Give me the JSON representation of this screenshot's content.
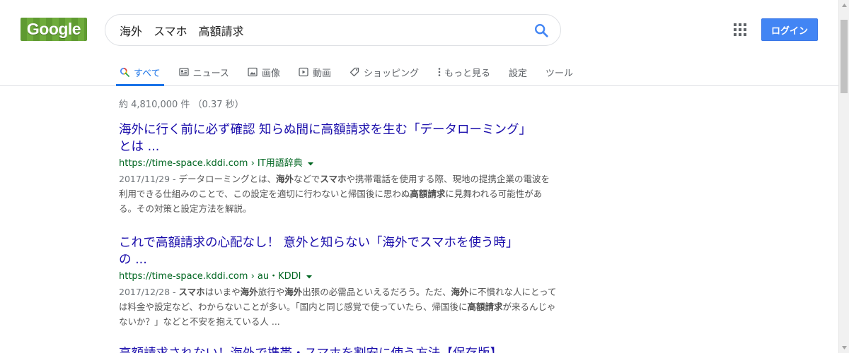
{
  "logo": {
    "text": "Google"
  },
  "search": {
    "query": "海外　スマホ　高額請求"
  },
  "header": {
    "login_label": "ログイン"
  },
  "tabs": [
    {
      "label": "すべて",
      "icon": "search-icon",
      "active": true
    },
    {
      "label": "ニュース",
      "icon": "news-icon"
    },
    {
      "label": "画像",
      "icon": "image-icon"
    },
    {
      "label": "動画",
      "icon": "video-icon"
    },
    {
      "label": "ショッピング",
      "icon": "tag-icon"
    },
    {
      "label": "もっと見る",
      "icon": "more-dots-icon"
    },
    {
      "label": "設定"
    },
    {
      "label": "ツール"
    }
  ],
  "stats": "約 4,810,000 件 （0.37 秒）",
  "results": [
    {
      "title_line1": "海外に行く前に必ず確認 知らぬ間に高額請求を生む「データローミング」",
      "title_line2": "とは ...",
      "url": "https://time-space.kddi.com › IT用語辞典",
      "date": "2017/11/29 - ",
      "snippet": [
        "データローミングとは、",
        {
          "b": "海外"
        },
        "などで",
        {
          "b": "スマホ"
        },
        "や携帯電話を使用する際、現地の提携企業の電波を利用できる仕組みのことで、この設定を適切に行わないと帰国後に思わぬ",
        {
          "b": "高額請求"
        },
        "に見舞われる可能性がある。その対策と設定方法を解説。"
      ]
    },
    {
      "title_line1": "これで高額請求の心配なし！ 意外と知らない「海外でスマホを使う時」",
      "title_line2": "の ...",
      "url": "https://time-space.kddi.com › au・KDDI",
      "date": "2017/12/28 - ",
      "snippet": [
        {
          "b": "スマホ"
        },
        "はいまや",
        {
          "b": "海外"
        },
        "旅行や",
        {
          "b": "海外"
        },
        "出張の必需品といえるだろう。ただ、",
        {
          "b": "海外"
        },
        "に不慣れな人にとっては料金や設定など、わからないことが多い。「国内と同じ感覚で使っていたら、帰国後に",
        {
          "b": "高額請求"
        },
        "が来るんじゃないか？」などと不安を抱えている人 ..."
      ]
    },
    {
      "title_line1": "高額請求されない！海外で携帯・スマホを割安に使う方法【保存版】"
    }
  ],
  "colors": {
    "link": "#1a0dab",
    "url_green": "#006621",
    "accent_blue": "#1a73e8",
    "button_blue": "#4285f4"
  }
}
